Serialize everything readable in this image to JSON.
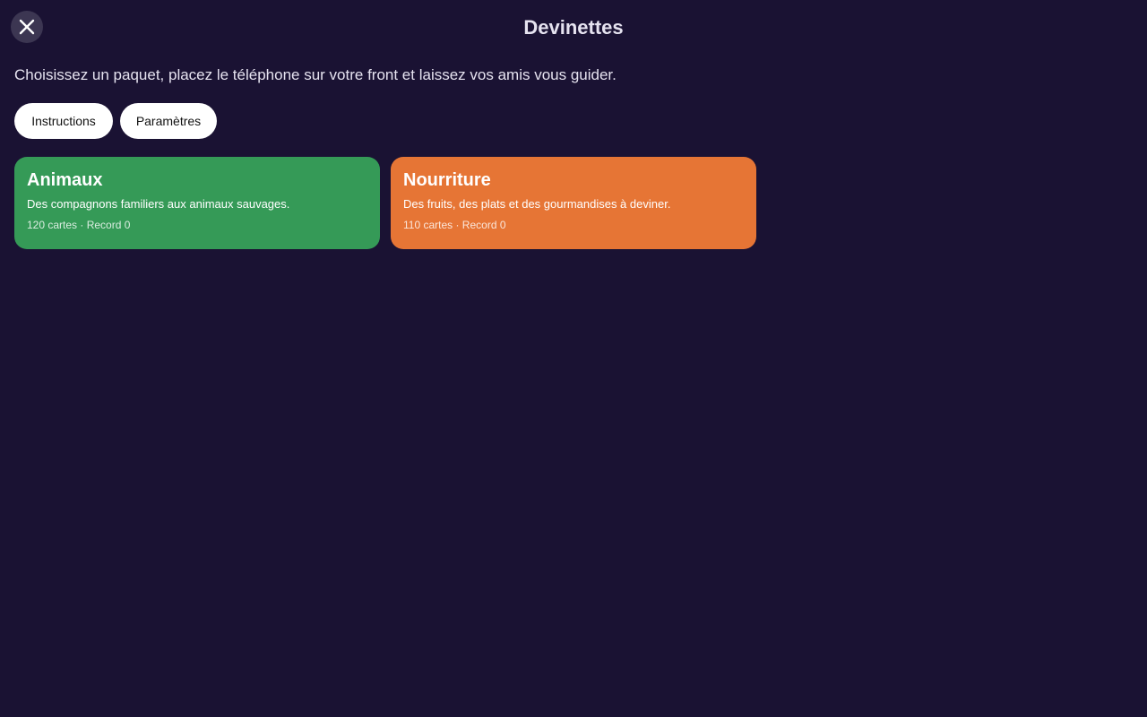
{
  "header": {
    "title": "Devinettes",
    "close_icon": "close-icon"
  },
  "intro": {
    "text": "Choisissez un paquet, placez le téléphone sur votre front et laissez vos amis vous guider."
  },
  "actions": {
    "instructions_label": "Instructions",
    "settings_label": "Paramètres"
  },
  "decks": [
    {
      "title": "Animaux",
      "description": "Des compagnons familiers aux animaux sauvages.",
      "meta": "120 cartes · Record 0",
      "color": "#359a57"
    },
    {
      "title": "Nourriture",
      "description": "Des fruits, des plats et des gourmandises à deviner.",
      "meta": "110 cartes · Record 0",
      "color": "#e67535"
    }
  ],
  "colors": {
    "background": "#1a1233",
    "close_button_bg": "#3c3652"
  }
}
